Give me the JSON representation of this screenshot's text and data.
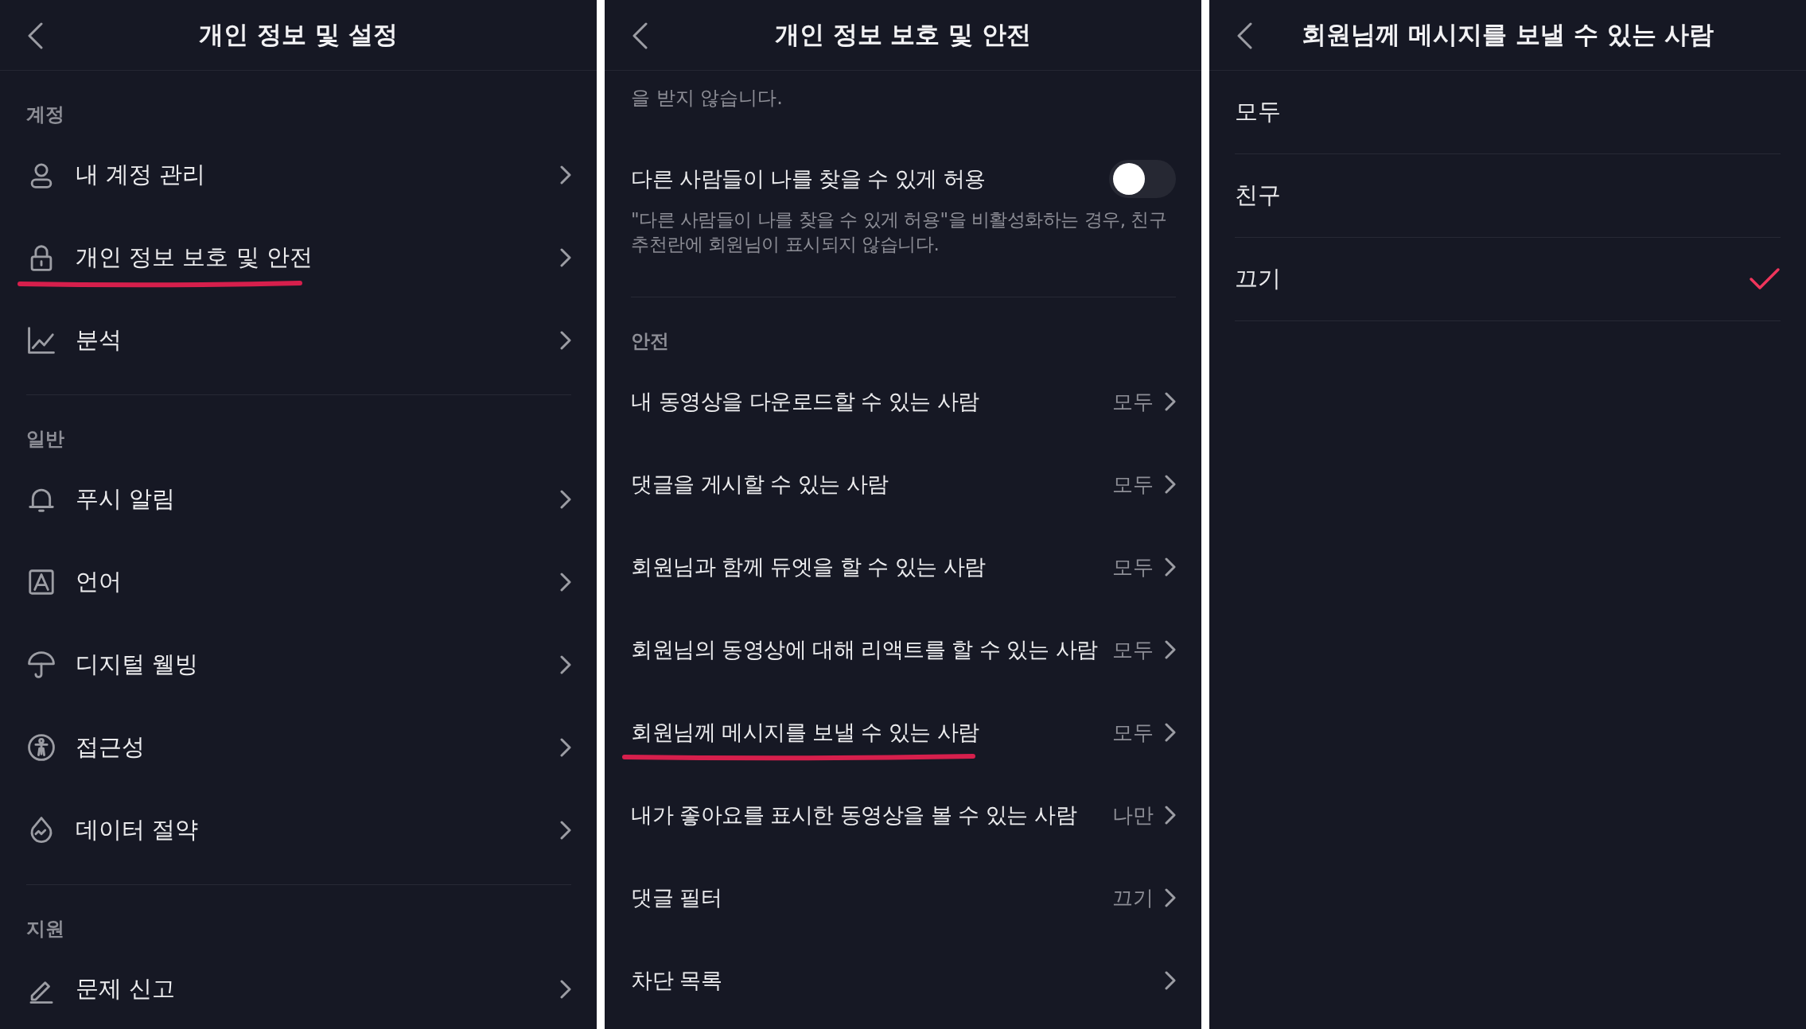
{
  "settings_screen": {
    "title": "개인 정보 및 설정",
    "sections": [
      {
        "label": "계정",
        "items": [
          {
            "label": "내 계정 관리",
            "underlined": false
          },
          {
            "label": "개인 정보 보호 및 안전",
            "underlined": true
          },
          {
            "label": "분석",
            "underlined": false
          }
        ]
      },
      {
        "label": "일반",
        "items": [
          {
            "label": "푸시 알림",
            "underlined": false
          },
          {
            "label": "언어",
            "underlined": false
          },
          {
            "label": "디지털 웰빙",
            "underlined": false
          },
          {
            "label": "접근성",
            "underlined": false
          },
          {
            "label": "데이터 절약",
            "underlined": false
          }
        ]
      },
      {
        "label": "지원",
        "items": [
          {
            "label": "문제 신고",
            "underlined": false
          }
        ]
      }
    ]
  },
  "privacy_screen": {
    "title": "개인 정보 보호 및 안전",
    "intro_tail": "을 받지 않습니다.",
    "discoverable": {
      "label": "다른 사람들이 나를 찾을 수 있게 허용",
      "on": false,
      "description": "\"다른 사람들이 나를 찾을 수 있게 허용\"을 비활성화하는 경우, 친구 추천란에 회원님이 표시되지 않습니다."
    },
    "safety": {
      "label": "안전",
      "items": [
        {
          "label": "내 동영상을 다운로드할 수 있는 사람",
          "value": "모두",
          "underlined": false
        },
        {
          "label": "댓글을 게시할 수 있는 사람",
          "value": "모두",
          "underlined": false
        },
        {
          "label": "회원님과 함께 듀엣을 할 수 있는 사람",
          "value": "모두",
          "underlined": false
        },
        {
          "label": "회원님의 동영상에 대해 리액트를 할 수 있는 사람",
          "value": "모두",
          "underlined": false
        },
        {
          "label": "회원님께 메시지를 보낼 수 있는 사람",
          "value": "모두",
          "underlined": true
        },
        {
          "label": "내가 좋아요를 표시한 동영상을 볼 수 있는 사람",
          "value": "나만",
          "underlined": false
        },
        {
          "label": "댓글 필터",
          "value": "끄기",
          "underlined": false
        },
        {
          "label": "차단 목록",
          "underlined": false
        }
      ]
    }
  },
  "messages_screen": {
    "title": "회원님께 메시지를 보낼 수 있는 사람",
    "options": [
      {
        "label": "모두",
        "selected": false
      },
      {
        "label": "친구",
        "selected": false
      },
      {
        "label": "끄기",
        "selected": true
      }
    ]
  }
}
